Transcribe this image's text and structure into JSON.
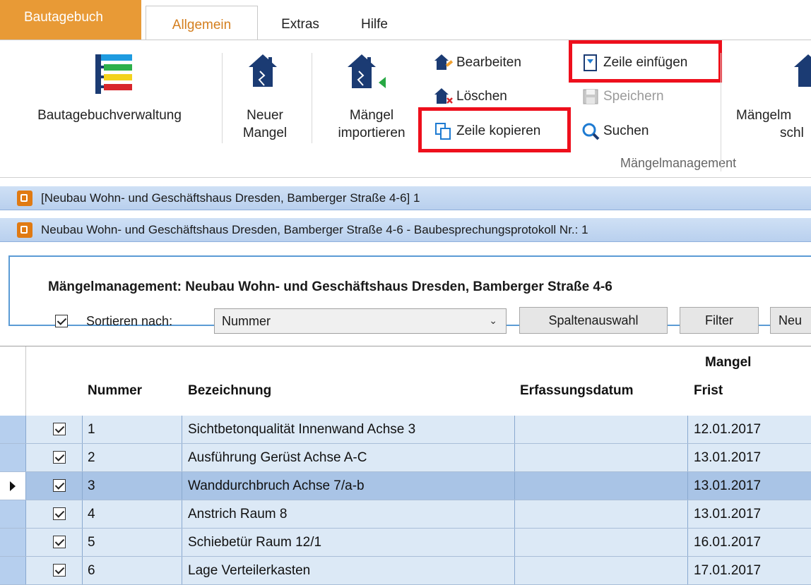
{
  "ribbon_tabs": {
    "file": "Bautagebuch",
    "allgemein": "Allgemein",
    "extras": "Extras",
    "hilfe": "Hilfe"
  },
  "ribbon": {
    "bautagebuchverwaltung": "Bautagebuchverwaltung",
    "neuer_mangel_1": "Neuer",
    "neuer_mangel_2": "Mangel",
    "maengel_import_1": "Mängel",
    "maengel_import_2": "importieren",
    "bearbeiten": "Bearbeiten",
    "loeschen": "Löschen",
    "zeile_kopieren": "Zeile kopieren",
    "zeile_einfuegen": "Zeile einfügen",
    "speichern": "Speichern",
    "suchen": "Suchen",
    "maengelmeldung_1": "Mängelm",
    "maengelmeldung_2": "schl",
    "group_label": "Mängelmanagement"
  },
  "docbars": {
    "bar1": "[Neubau Wohn- und Geschäftshaus Dresden, Bamberger Straße 4-6] 1",
    "bar2": "Neubau Wohn- und Geschäftshaus Dresden, Bamberger Straße 4-6 - Baubesprechungsprotokoll Nr.: 1"
  },
  "panel": {
    "title": "Mängelmanagement: Neubau Wohn- und Geschäftshaus Dresden, Bamberger Straße 4-6",
    "sort_label": "Sortieren nach:",
    "sort_value": "Nummer",
    "spaltenauswahl": "Spaltenauswahl",
    "filter": "Filter",
    "neu": "Neu"
  },
  "grid": {
    "group_header": "Mangel",
    "headers": {
      "nummer": "Nummer",
      "bezeichnung": "Bezeichnung",
      "erfassungsdatum": "Erfassungsdatum",
      "frist": "Frist"
    },
    "rows": [
      {
        "nummer": "1",
        "bezeichnung": "Sichtbetonqualität Innenwand Achse 3",
        "erfassungsdatum": "",
        "frist": "12.01.2017",
        "checked": true
      },
      {
        "nummer": "2",
        "bezeichnung": "Ausführung Gerüst Achse A-C",
        "erfassungsdatum": "",
        "frist": "13.01.2017",
        "checked": true
      },
      {
        "nummer": "3",
        "bezeichnung": "Wanddurchbruch Achse 7/a-b",
        "erfassungsdatum": "",
        "frist": "13.01.2017",
        "checked": true
      },
      {
        "nummer": "4",
        "bezeichnung": "Anstrich Raum 8",
        "erfassungsdatum": "",
        "frist": "13.01.2017",
        "checked": true
      },
      {
        "nummer": "5",
        "bezeichnung": "Schiebetür Raum 12/1",
        "erfassungsdatum": "",
        "frist": "16.01.2017",
        "checked": true
      },
      {
        "nummer": "6",
        "bezeichnung": "Lage Verteilerkasten",
        "erfassungsdatum": "",
        "frist": "17.01.2017",
        "checked": true
      }
    ]
  },
  "colors": {
    "file_tab": "#e89a36",
    "active_tab_text": "#d47f1f",
    "highlight": "#ee0f1c",
    "row_bg": "#dce9f6",
    "row_selected_bg": "#a9c4e6",
    "icon_navy": "#1b3b73"
  },
  "icons": [
    "document-list-icon",
    "house-icon",
    "house-import-icon",
    "house-edit-icon",
    "house-delete-icon",
    "copy-row-icon",
    "insert-row-icon",
    "save-icon",
    "search-icon",
    "document-icon",
    "row-pointer-icon"
  ]
}
